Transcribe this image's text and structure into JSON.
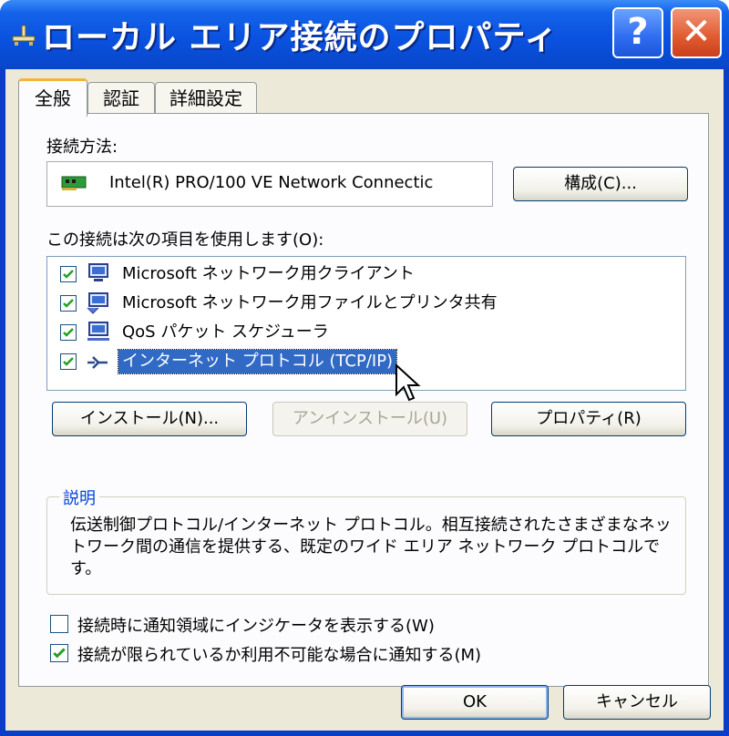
{
  "window": {
    "title": "ローカル エリア接続のプロパティ",
    "help_glyph": "?",
    "close_glyph": "✕"
  },
  "tabs": [
    {
      "label": "全般",
      "active": true
    },
    {
      "label": "認証",
      "active": false
    },
    {
      "label": "詳細設定",
      "active": false
    }
  ],
  "general": {
    "connect_using_label": "接続方法:",
    "adapter_name": "Intel(R) PRO/100 VE Network Connectic",
    "configure_button": "構成(C)...",
    "components_label": "この接続は次の項目を使用します(O):",
    "components": [
      {
        "label": "Microsoft ネットワーク用クライアント",
        "checked": true,
        "selected": false,
        "icon": "network-client-icon"
      },
      {
        "label": "Microsoft ネットワーク用ファイルとプリンタ共有",
        "checked": true,
        "selected": false,
        "icon": "file-printer-sharing-icon"
      },
      {
        "label": "QoS パケット スケジューラ",
        "checked": true,
        "selected": false,
        "icon": "qos-scheduler-icon"
      },
      {
        "label": "インターネット プロトコル (TCP/IP)",
        "checked": true,
        "selected": true,
        "icon": "protocol-icon"
      }
    ],
    "install_button": "インストール(N)...",
    "uninstall_button": "アンインストール(U)",
    "properties_button": "プロパティ(R)",
    "description_title": "説明",
    "description_text": "伝送制御プロトコル/インターネット プロトコル。相互接続されたさまざまなネットワーク間の通信を提供する、既定のワイド エリア ネットワーク プロトコルです。",
    "show_icon_option": {
      "label": "接続時に通知領域にインジケータを表示する(W)",
      "checked": false
    },
    "notify_option": {
      "label": "接続が限られているか利用不可能な場合に通知する(M)",
      "checked": true
    }
  },
  "footer": {
    "ok_button": "OK",
    "cancel_button": "キャンセル"
  },
  "colors": {
    "titlebar": "#0a52e0",
    "selection": "#316ac5",
    "group_title": "#0046d5",
    "close_button": "#e05a2f"
  }
}
